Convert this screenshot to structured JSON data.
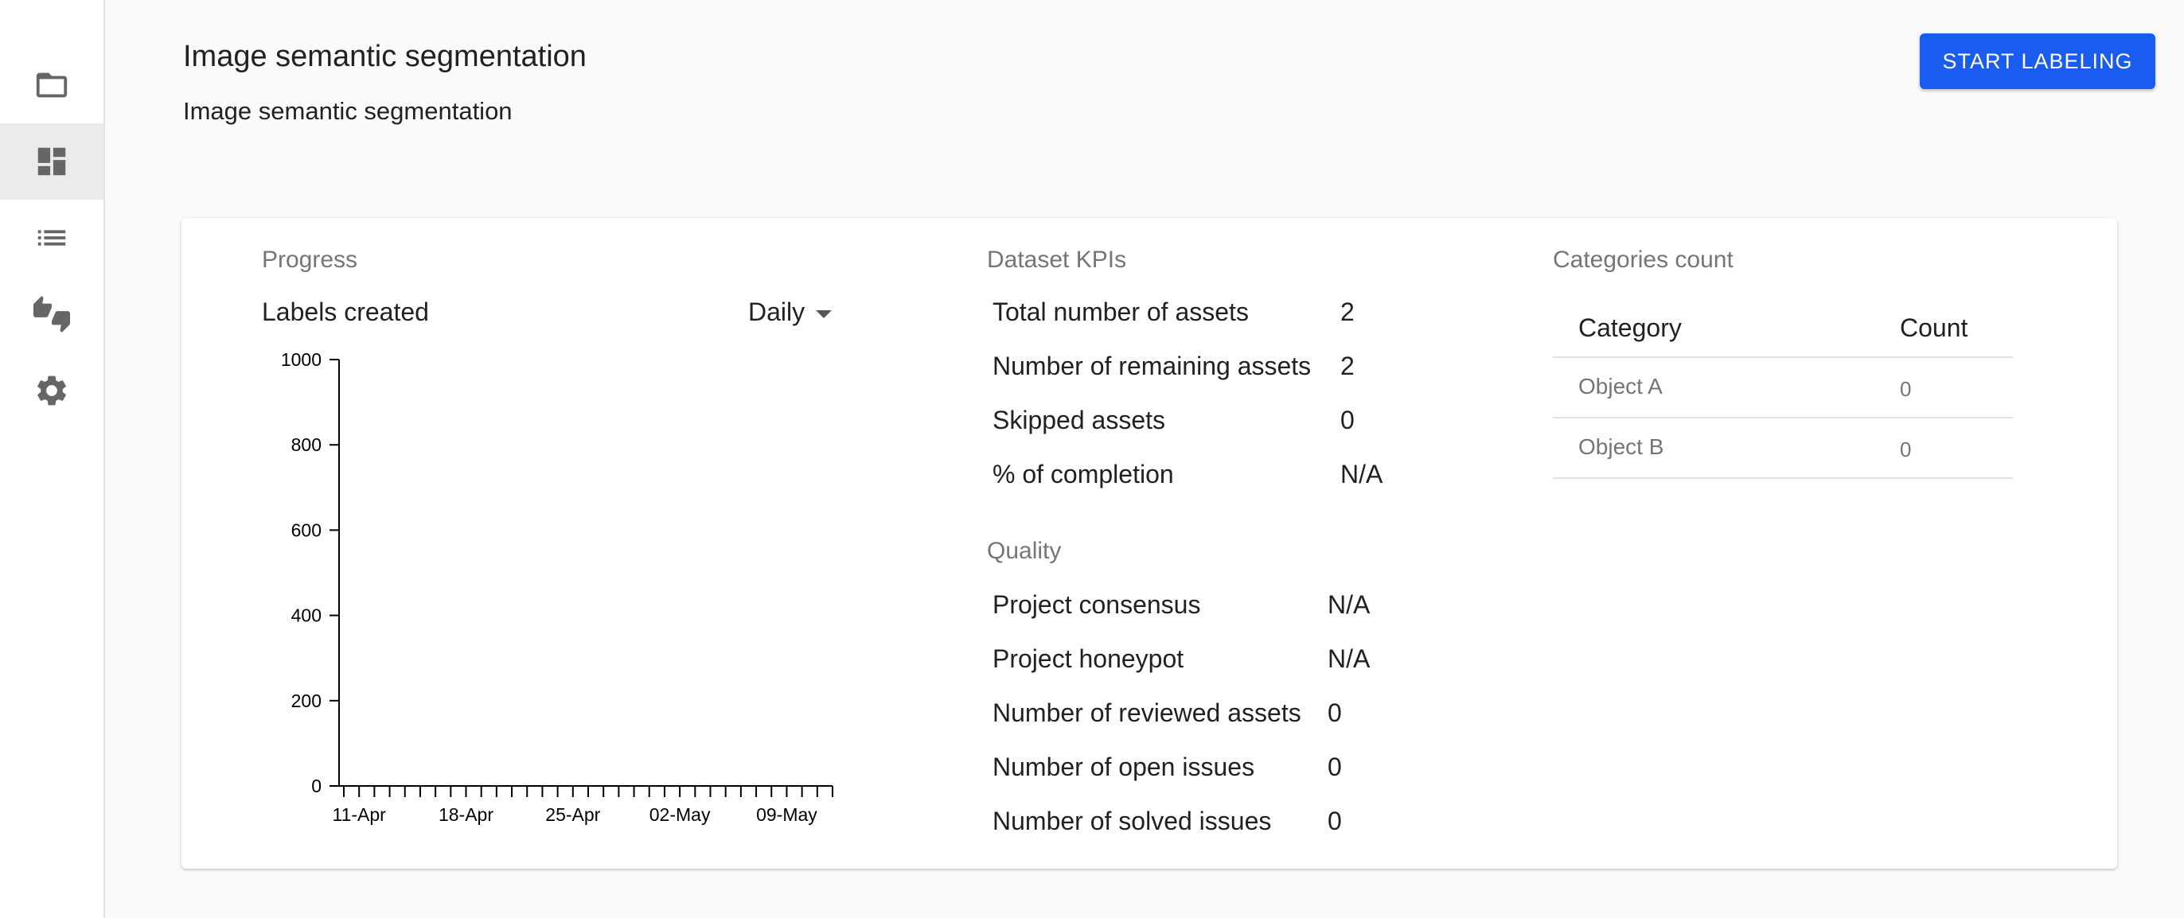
{
  "header": {
    "title": "Image semantic segmentation",
    "subtitle": "Image semantic segmentation",
    "start_button_label": "START LABELING"
  },
  "sidebar": {
    "items": [
      {
        "icon": "folder-icon",
        "active": false
      },
      {
        "icon": "dashboard-icon",
        "active": true
      },
      {
        "icon": "list-icon",
        "active": false
      },
      {
        "icon": "thumbs-up-down-icon",
        "active": false
      },
      {
        "icon": "gear-icon",
        "active": false
      }
    ]
  },
  "progress": {
    "section_title": "Progress",
    "chart_title": "Labels created",
    "period_selected": "Daily"
  },
  "chart_data": {
    "type": "bar",
    "title": "Labels created",
    "xlabel": "",
    "ylabel": "",
    "ylim": [
      0,
      1000
    ],
    "yticks": [
      0,
      200,
      400,
      600,
      800,
      1000
    ],
    "ytick_labels": [
      "0",
      "200",
      "400",
      "600",
      "800",
      "1000"
    ],
    "xtick_labels": [
      "11-Apr",
      "18-Apr",
      "25-Apr",
      "02-May",
      "09-May"
    ],
    "x_tick_count": 33,
    "series": [
      {
        "values": []
      }
    ],
    "grid": false,
    "colors": {
      "axis": "#000000"
    }
  },
  "kpis": {
    "section_title": "Dataset KPIs",
    "rows": [
      {
        "label": "Total number of assets",
        "value": "2"
      },
      {
        "label": "Number of remaining assets",
        "value": "2"
      },
      {
        "label": "Skipped assets",
        "value": "0"
      },
      {
        "label": "% of completion",
        "value": "N/A"
      }
    ]
  },
  "quality": {
    "section_title": "Quality",
    "rows": [
      {
        "label": "Project consensus",
        "value": "N/A"
      },
      {
        "label": "Project honeypot",
        "value": "N/A"
      },
      {
        "label": "Number of reviewed assets",
        "value": "0"
      },
      {
        "label": "Number of open issues",
        "value": "0"
      },
      {
        "label": "Number of solved issues",
        "value": "0"
      }
    ]
  },
  "categories": {
    "section_title": "Categories count",
    "headers": {
      "category": "Category",
      "count": "Count"
    },
    "rows": [
      {
        "category": "Object A",
        "count": "0"
      },
      {
        "category": "Object B",
        "count": "0"
      }
    ]
  },
  "colors": {
    "accent": "#1a5cf0",
    "muted_text": "#757575",
    "sidebar_active": "#ebebeb"
  }
}
